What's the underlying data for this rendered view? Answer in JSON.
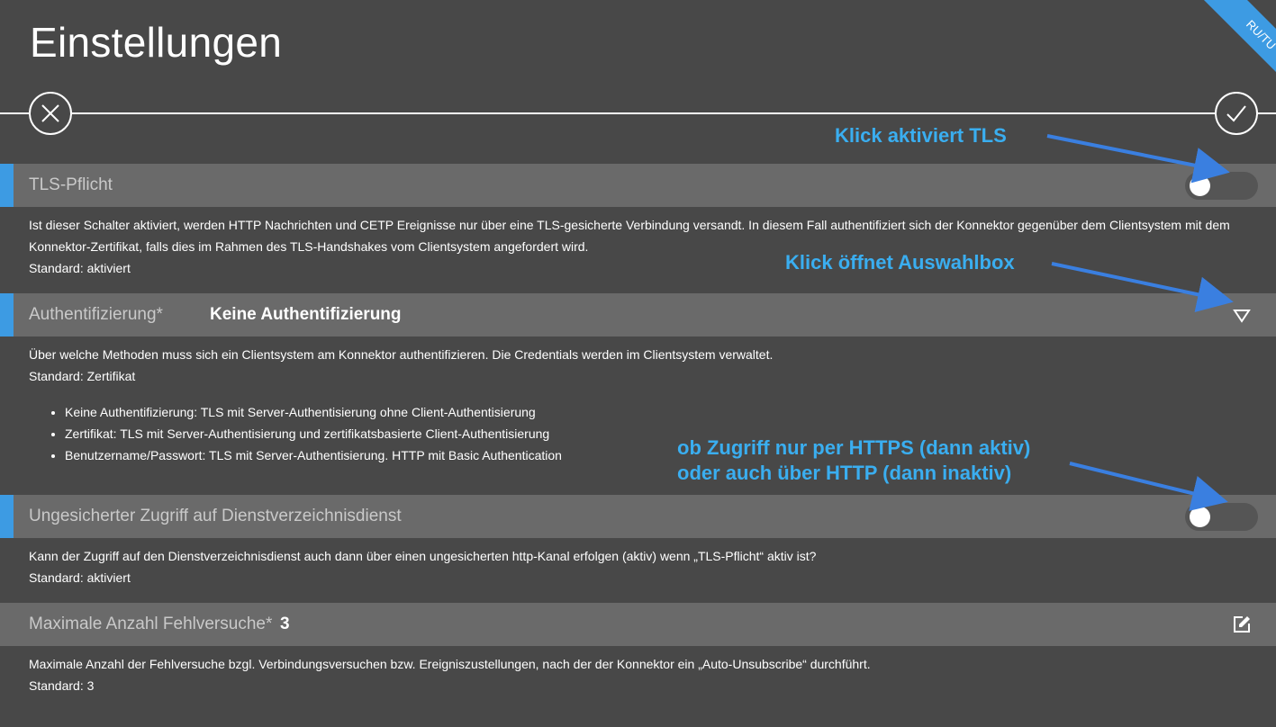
{
  "page": {
    "title": "Einstellungen",
    "badge": "RU/TU"
  },
  "settings": [
    {
      "label": "TLS-Pflicht",
      "description": "Ist dieser Schalter aktiviert, werden HTTP Nachrichten und CETP Ereignisse nur über eine TLS-gesicherte Verbindung versandt. In diesem Fall authentifiziert sich der Konnektor gegenüber dem Clientsystem mit dem Konnektor-Zertifikat, falls dies im Rahmen des TLS-Handshakes vom Clientsystem angefordert wird.",
      "default": "Standard: aktiviert"
    },
    {
      "label": "Authentifizierung*",
      "value": "Keine Authentifizierung",
      "description": "Über welche Methoden muss sich ein Clientsystem am Konnektor authentifizieren. Die Credentials werden im Clientsystem verwaltet.",
      "default": "Standard: Zertifikat",
      "options": [
        "Keine Authentifizierung: TLS mit Server-Authentisierung ohne Client-Authentisierung",
        "Zertifikat: TLS mit Server-Authentisierung und zertifikatsbasierte Client-Authentisierung",
        "Benutzername/Passwort: TLS mit Server-Authentisierung. HTTP mit Basic Authentication"
      ]
    },
    {
      "label": "Ungesicherter Zugriff auf Dienstverzeichnisdienst",
      "description": "Kann der Zugriff auf den Dienstverzeichnisdienst auch dann über einen ungesicherten http-Kanal erfolgen (aktiv) wenn „TLS-Pflicht“ aktiv ist?",
      "default": "Standard: aktiviert"
    },
    {
      "label": "Maximale Anzahl Fehlversuche*",
      "value": "3",
      "description": "Maximale Anzahl der Fehlversuche bzgl. Verbindungsversuchen bzw. Ereigniszustellungen, nach der der Konnektor ein „Auto-Unsubscribe“ durchführt.",
      "default": "Standard: 3"
    }
  ],
  "annotations": {
    "tls": "Klick aktiviert TLS",
    "auth": "Klick öffnet Auswahlbox",
    "access_line1": "ob Zugriff nur per HTTPS (dann aktiv)",
    "access_line2": "oder auch über HTTP (dann inaktiv)"
  },
  "colors": {
    "background": "#484848",
    "row": "#6a6a6a",
    "accent": "#3d9be3",
    "annotation": "#3aaef0"
  },
  "icons": {
    "cancel": "close-icon",
    "confirm": "checkmark-icon",
    "dropdown": "triangle-down-icon",
    "edit": "edit-icon"
  }
}
